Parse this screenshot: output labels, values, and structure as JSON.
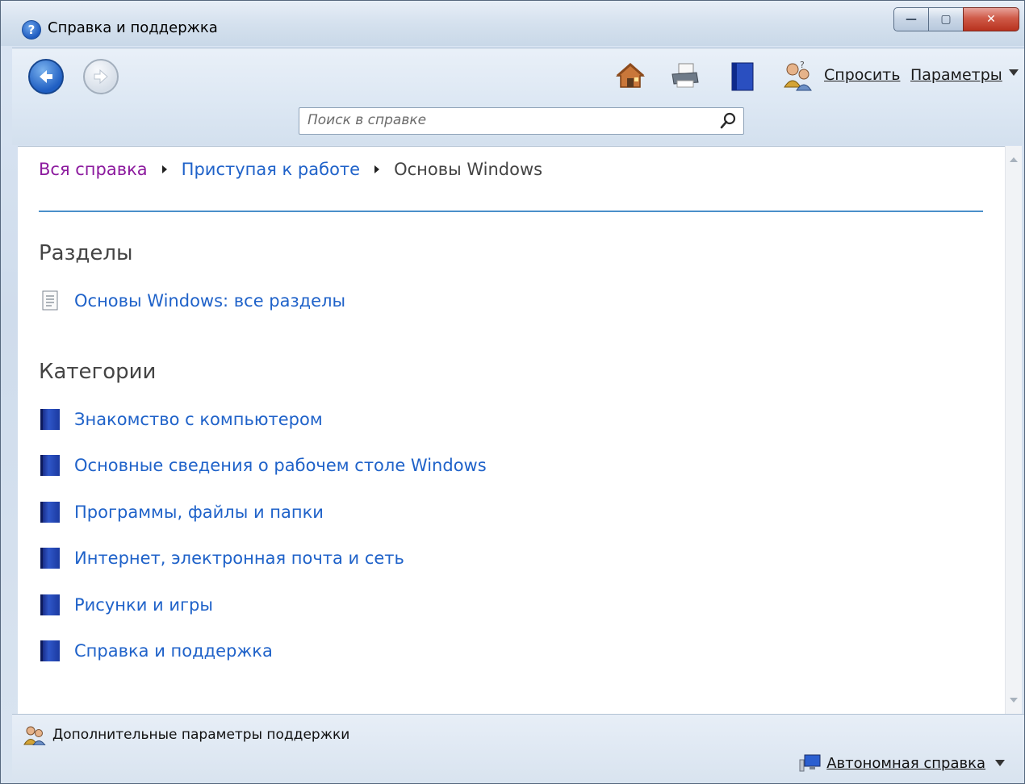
{
  "window": {
    "title": "Справка и поддержка",
    "controls": {
      "minimize": "—",
      "maximize": "▢",
      "close": "✕"
    }
  },
  "toolbar": {
    "back_icon": "back-arrow-icon",
    "forward_icon": "forward-arrow-icon",
    "home_icon": "home-icon",
    "print_icon": "printer-icon",
    "browse_icon": "book-icon",
    "ask_icon": "people-help-icon",
    "ask_label": "Спросить",
    "options_label": "Параметры",
    "search_placeholder": "Поиск в справке"
  },
  "breadcrumb": {
    "items": [
      "Вся справка",
      "Приступая к работе",
      "Основы Windows"
    ]
  },
  "sections": {
    "topics_title": "Разделы",
    "topics": [
      {
        "label": "Основы Windows: все разделы",
        "icon": "topic-page-icon"
      }
    ],
    "categories_title": "Категории",
    "categories": [
      {
        "label": "Знакомство с компьютером",
        "icon": "book-icon"
      },
      {
        "label": "Основные сведения о рабочем столе Windows",
        "icon": "book-icon"
      },
      {
        "label": "Программы, файлы и папки",
        "icon": "book-icon"
      },
      {
        "label": "Интернет, электронная почта и сеть",
        "icon": "book-icon"
      },
      {
        "label": "Рисунки и игры",
        "icon": "book-icon"
      },
      {
        "label": "Справка и поддержка",
        "icon": "book-icon"
      }
    ]
  },
  "statusbar": {
    "more_support_label": "Дополнительные параметры поддержки",
    "offline_help_label": "Автономная справка"
  },
  "colors": {
    "link": "#1f62c9",
    "visited_link": "#8c1a9e",
    "divider": "#4a8fc9",
    "section_title": "#444444"
  }
}
